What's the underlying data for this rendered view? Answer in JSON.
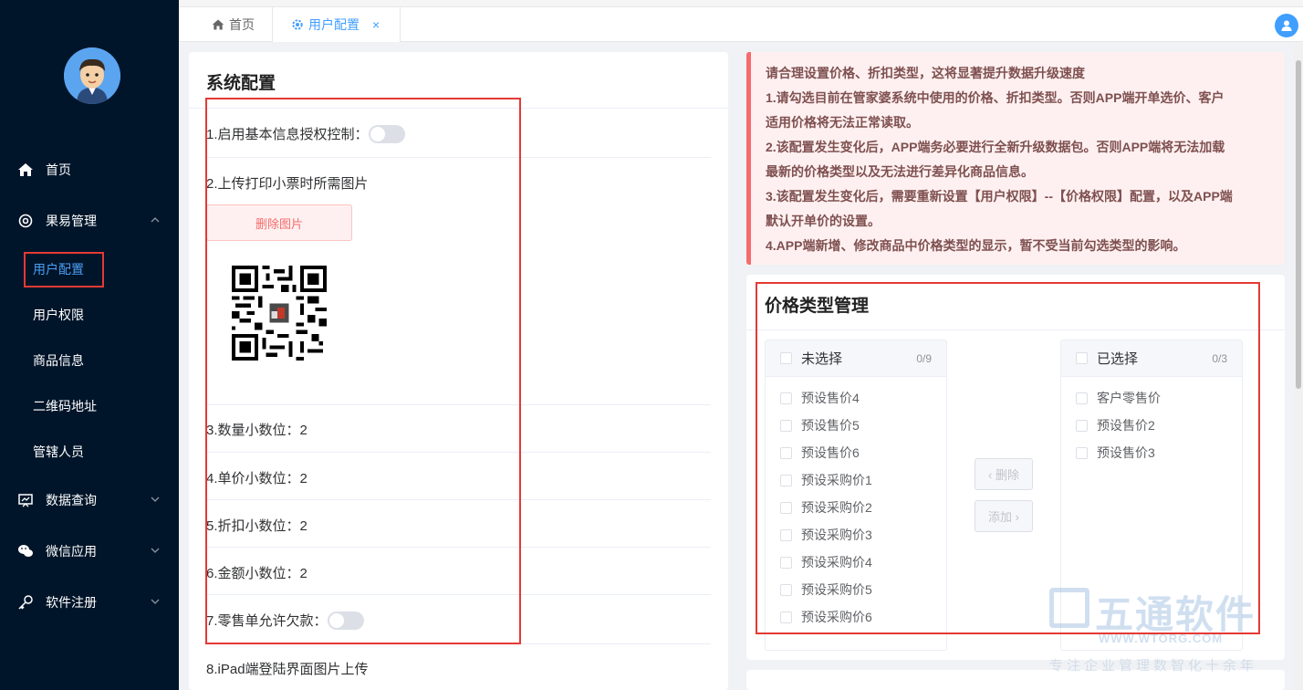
{
  "sidebar": {
    "items": [
      {
        "label": "首页",
        "icon": "home-icon"
      },
      {
        "label": "果易管理",
        "icon": "gear-icon"
      },
      {
        "label": "数据查询",
        "icon": "chart-icon"
      },
      {
        "label": "微信应用",
        "icon": "wechat-icon"
      },
      {
        "label": "软件注册",
        "icon": "key-icon"
      }
    ],
    "subitems": [
      "用户配置",
      "用户权限",
      "商品信息",
      "二维码地址",
      "管辖人员"
    ]
  },
  "tabs": [
    {
      "label": "首页",
      "icon": "home-icon"
    },
    {
      "label": "用户配置",
      "icon": "gear-icon",
      "close": "×"
    }
  ],
  "system": {
    "title": "系统配置",
    "settings": {
      "s1": "1.启用基本信息授权控制：",
      "s2": "2.上传打印小票时所需图片",
      "s3": "3.数量小数位：2",
      "s4": "4.单价小数位：2",
      "s5": "5.折扣小数位：2",
      "s6": "6.金额小数位：2",
      "s7": "7.零售单允许欠款：",
      "s8": "8.iPad端登陆界面图片上传"
    },
    "delete_button": "删除图片"
  },
  "notice": {
    "lines": [
      "请合理设置价格、折扣类型，这将显著提升数据升级速度",
      "1.请勾选目前在管家婆系统中使用的价格、折扣类型。否则APP端开单选价、客户",
      "适用价格将无法正常读取。",
      "2.该配置发生变化后，APP端务必要进行全新升级数据包。否则APP端将无法加载",
      "最新的价格类型以及无法进行差异化商品信息。",
      "3.该配置发生变化后，需要重新设置【用户权限】--【价格权限】配置，以及APP端",
      "默认开单价的设置。",
      "4.APP端新增、修改商品中价格类型的显示，暂不受当前勾选类型的影响。"
    ]
  },
  "price": {
    "title": "价格类型管理",
    "left": {
      "title": "未选择",
      "count": "0/9",
      "items": [
        "预设售价4",
        "预设售价5",
        "预设售价6",
        "预设采购价1",
        "预设采购价2",
        "预设采购价3",
        "预设采购价4",
        "预设采购价5",
        "预设采购价6"
      ]
    },
    "right": {
      "title": "已选择",
      "count": "0/3",
      "items": [
        "客户零售价",
        "预设售价2",
        "预设售价3"
      ]
    },
    "remove_button": "‹ 删除",
    "add_button": "添加 ›"
  },
  "watermark": {
    "brand": "五通软件",
    "url": "WWW.WTORG.COM",
    "slogan": "专注企业管理数智化十余年"
  }
}
